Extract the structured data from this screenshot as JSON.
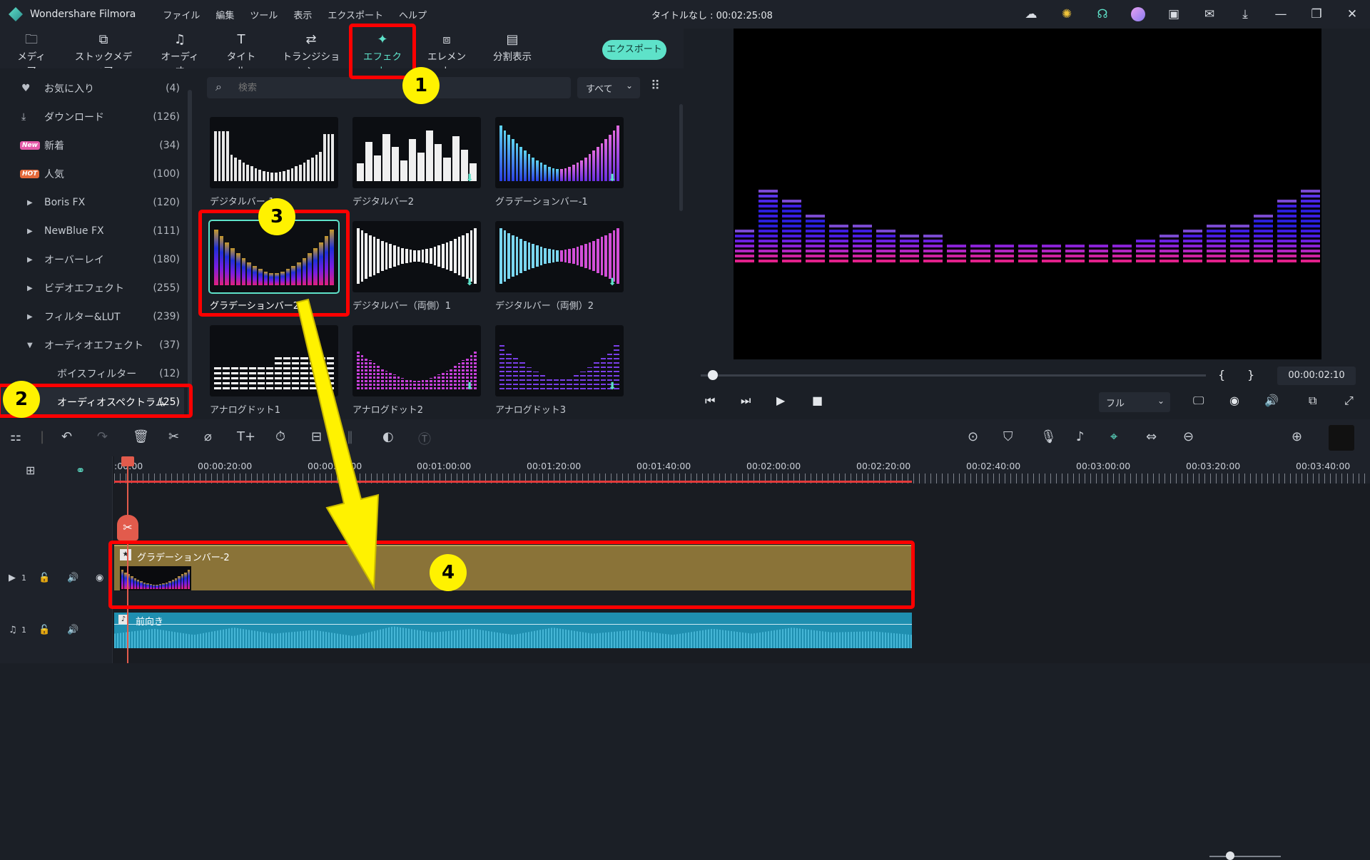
{
  "app": {
    "name": "Wondershare Filmora",
    "doc_title": "タイトルなし : 00:02:25:08"
  },
  "menu": [
    "ファイル",
    "編集",
    "ツール",
    "表示",
    "エクスポート",
    "ヘルプ"
  ],
  "title_icons": [
    "cloud-icon",
    "lightbulb-icon",
    "headset-icon",
    "avatar",
    "save-icon",
    "mail-icon",
    "download-icon",
    "minimize-icon",
    "restore-icon",
    "close-icon"
  ],
  "toolbar": {
    "tabs": [
      {
        "label": "メディア",
        "icon": "folder-icon"
      },
      {
        "label": "ストックメディア",
        "icon": "stock-icon"
      },
      {
        "label": "オーディオ",
        "icon": "music-icon"
      },
      {
        "label": "タイトル",
        "icon": "title-icon"
      },
      {
        "label": "トランジション",
        "icon": "transition-icon"
      },
      {
        "label": "エフェクト",
        "icon": "effect-icon",
        "active": true
      },
      {
        "label": "エレメント",
        "icon": "element-icon"
      },
      {
        "label": "分割表示",
        "icon": "split-icon"
      }
    ],
    "export_label": "エクスポート"
  },
  "sidebar": {
    "items": [
      {
        "label": "お気に入り",
        "count": "(4)",
        "icon": "heart-icon"
      },
      {
        "label": "ダウンロード",
        "count": "(126)",
        "icon": "download-icon"
      },
      {
        "label": "新着",
        "count": "(34)",
        "badge": "New"
      },
      {
        "label": "人気",
        "count": "(100)",
        "badge": "HOT"
      },
      {
        "label": "Boris FX",
        "count": "(120)",
        "icon": "caret-right-icon"
      },
      {
        "label": "NewBlue FX",
        "count": "(111)",
        "icon": "caret-right-icon"
      },
      {
        "label": "オーバーレイ",
        "count": "(180)",
        "icon": "caret-right-icon"
      },
      {
        "label": "ビデオエフェクト",
        "count": "(255)",
        "icon": "caret-right-icon"
      },
      {
        "label": "フィルター&LUT",
        "count": "(239)",
        "icon": "caret-right-icon"
      },
      {
        "label": "オーディオエフェクト",
        "count": "(37)",
        "icon": "caret-down-icon"
      },
      {
        "label": "ボイスフィルター",
        "count": "(12)"
      },
      {
        "label": "オーディオスペクトラム",
        "count": "(25)",
        "selected": true
      }
    ]
  },
  "search": {
    "placeholder": "検索",
    "filter": "すべて"
  },
  "effects": [
    {
      "label": "デジタルバー-1"
    },
    {
      "label": "デジタルバー2"
    },
    {
      "label": "グラデーションバー-1"
    },
    {
      "label": "グラデーションバー2",
      "selected": true
    },
    {
      "label": "デジタルバー（両側）1"
    },
    {
      "label": "デジタルバー（両側）2"
    },
    {
      "label": "アナログドット1"
    },
    {
      "label": "アナログドット2"
    },
    {
      "label": "アナログドット3"
    }
  ],
  "preview": {
    "timecode": "00:00:02:10",
    "quality": "フル",
    "brace_open": "{",
    "brace_close": "}"
  },
  "ruler": {
    "labels": [
      ":00:00",
      "00:00:20:00",
      "00:00:40:00",
      "00:01:00:00",
      "00:01:20:00",
      "00:01:40:00",
      "00:02:00:00",
      "00:02:20:00",
      "00:02:40:00",
      "00:03:00:00",
      "00:03:20:00",
      "00:03:40:00"
    ]
  },
  "tracks": {
    "video": {
      "index": "1",
      "clip": "グラデーションバー-2"
    },
    "audio": {
      "index": "1",
      "clip": "前向き"
    }
  },
  "annotations": [
    "1",
    "2",
    "3",
    "4"
  ],
  "colors": {
    "accent": "#5ee2c9",
    "highlight": "#ff0000",
    "marker": "#fff200",
    "video_clip": "#8a7338",
    "audio_clip": "#1f8fb0"
  }
}
